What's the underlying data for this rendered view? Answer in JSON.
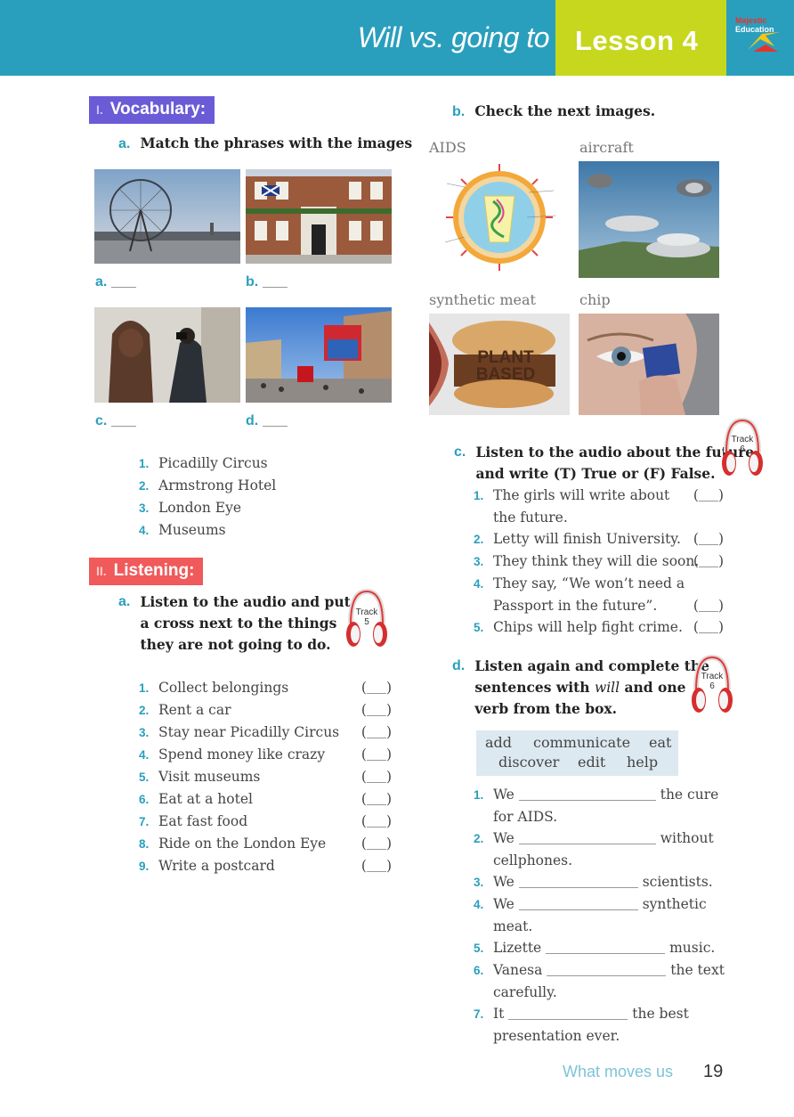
{
  "header": {
    "title": "Will vs. going to",
    "title_italic_part": "Will",
    "title_rest": "vs. going to",
    "lesson": "Lesson 4",
    "logo_text": "Majestic Education"
  },
  "vocabulary": {
    "number": "I.",
    "title": "Vocabulary:",
    "a_letter": "a.",
    "a_instruction": "Match the phrases with the images",
    "image_labels": [
      "a.",
      "b.",
      "c.",
      "d."
    ],
    "phrases": [
      {
        "n": "1.",
        "text": "Picadilly Circus"
      },
      {
        "n": "2.",
        "text": "Armstrong Hotel"
      },
      {
        "n": "3.",
        "text": "London Eye"
      },
      {
        "n": "4.",
        "text": "Museums"
      }
    ]
  },
  "listening": {
    "number": "II.",
    "title": "Listening:",
    "a_letter": "a.",
    "a_instruction_lines": [
      "Listen to the audio and put",
      "a cross next to the things",
      "they are not going to do."
    ],
    "track_a": {
      "word": "Track",
      "number": "5"
    },
    "items": [
      {
        "n": "1.",
        "text": "Collect belongings"
      },
      {
        "n": "2.",
        "text": "Rent a car"
      },
      {
        "n": "3.",
        "text": "Stay near Picadilly Circus"
      },
      {
        "n": "4.",
        "text": "Spend money like crazy"
      },
      {
        "n": "5.",
        "text": "Visit museums"
      },
      {
        "n": "6.",
        "text": "Eat at a hotel"
      },
      {
        "n": "7.",
        "text": "Eat fast food"
      },
      {
        "n": "8.",
        "text": "Ride on the London Eye"
      },
      {
        "n": "9.",
        "text": "Write a postcard"
      }
    ]
  },
  "check_images": {
    "letter": "b.",
    "instruction": "Check the next images.",
    "labels": [
      "AIDS",
      "aircraft",
      "synthetic meat",
      "chip"
    ],
    "burger_text": [
      "PLANT",
      "BASED"
    ]
  },
  "true_false": {
    "letter": "c.",
    "instruction_lines": [
      "Listen to the audio about the future",
      "and write (T) True or (F) False."
    ],
    "track": {
      "word": "Track",
      "number": "6"
    },
    "items": [
      {
        "n": "1.",
        "lines": [
          "The girls will write about",
          "the future."
        ]
      },
      {
        "n": "2.",
        "lines": [
          "Letty will finish University."
        ]
      },
      {
        "n": "3.",
        "lines": [
          "They think they will die soon."
        ]
      },
      {
        "n": "4.",
        "lines": [
          "They say, “We won’t need a",
          "Passport in the future”."
        ]
      },
      {
        "n": "5.",
        "lines": [
          "Chips will help fight crime."
        ]
      }
    ]
  },
  "complete": {
    "letter": "d.",
    "instruction_line1": "Listen again and complete the",
    "instruction_line2_before": "sentences with ",
    "instruction_line2_italic": "will",
    "instruction_line2_after": " and one",
    "instruction_line3": "verb from the box.",
    "track": {
      "word": "Track",
      "number": "6"
    },
    "word_box": [
      "add",
      "communicate",
      "eat",
      "discover",
      "edit",
      "help"
    ],
    "sentences": [
      {
        "n": "1.",
        "before": "We",
        "after": "the cure",
        "line2": "for AIDS."
      },
      {
        "n": "2.",
        "before": "We",
        "after": "without",
        "line2": "cellphones."
      },
      {
        "n": "3.",
        "before": "We",
        "after": "scientists.",
        "line2": ""
      },
      {
        "n": "4.",
        "before": "We",
        "after": "synthetic",
        "line2": "meat."
      },
      {
        "n": "5.",
        "before": "Lizette",
        "after": "music.",
        "line2": ""
      },
      {
        "n": "6.",
        "before": "Vanesa",
        "after": "the text",
        "line2": "carefully."
      },
      {
        "n": "7.",
        "before": "It",
        "after": "the best",
        "line2": "presentation ever."
      }
    ]
  },
  "footer": {
    "text": "What moves us",
    "page": "19"
  },
  "colors": {
    "header_blue": "#2a9fbd",
    "lesson_green": "#c6d71e",
    "vocab_purple": "#6b5bd6",
    "listening_red": "#f05a5a"
  }
}
